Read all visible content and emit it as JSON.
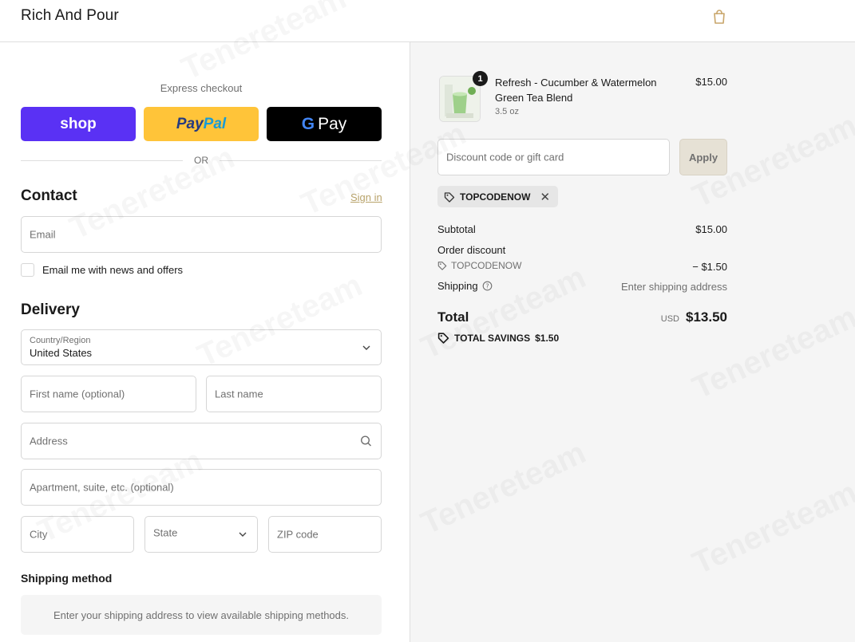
{
  "header": {
    "brand": "Rich And Pour",
    "cart_icon": "shopping-bag-icon"
  },
  "express": {
    "label": "Express checkout",
    "shop_label": "shop",
    "paypal_part1": "Pay",
    "paypal_part2": "Pal",
    "gpay_g": "G",
    "gpay_label": "Pay",
    "or": "OR"
  },
  "contact": {
    "title": "Contact",
    "signin": "Sign in",
    "email_placeholder": "Email",
    "newsletter_label": "Email me with news and offers"
  },
  "delivery": {
    "title": "Delivery",
    "country_label": "Country/Region",
    "country_value": "United States",
    "first_name_placeholder": "First name (optional)",
    "last_name_placeholder": "Last name",
    "address_placeholder": "Address",
    "apartment_placeholder": "Apartment, suite, etc. (optional)",
    "city_placeholder": "City",
    "state_placeholder": "State",
    "zip_placeholder": "ZIP code"
  },
  "shipping_method": {
    "title": "Shipping method",
    "message": "Enter your shipping address to view available shipping methods."
  },
  "summary": {
    "product": {
      "quantity": "1",
      "name": "Refresh - Cucumber & Watermelon Green Tea Blend",
      "variant": "3.5 oz",
      "price": "$15.00"
    },
    "discount_placeholder": "Discount code or gift card",
    "apply_label": "Apply",
    "applied_code": "TOPCODENOW",
    "subtotal_label": "Subtotal",
    "subtotal_value": "$15.00",
    "order_discount_label": "Order discount",
    "order_discount_code": "TOPCODENOW",
    "order_discount_value": "− $1.50",
    "shipping_label": "Shipping",
    "shipping_value": "Enter shipping address",
    "total_label": "Total",
    "currency": "USD",
    "total_value": "$13.50",
    "savings_label": "TOTAL SAVINGS",
    "savings_value": "$1.50"
  },
  "watermark": "Tenereteam",
  "colors": {
    "shop_purple": "#5a31f4",
    "paypal_yellow": "#ffc439",
    "gpay_black": "#000000",
    "link_gold": "#b8a36a",
    "panel_bg": "#f5f5f5",
    "apply_bg": "#e6e1d5"
  }
}
